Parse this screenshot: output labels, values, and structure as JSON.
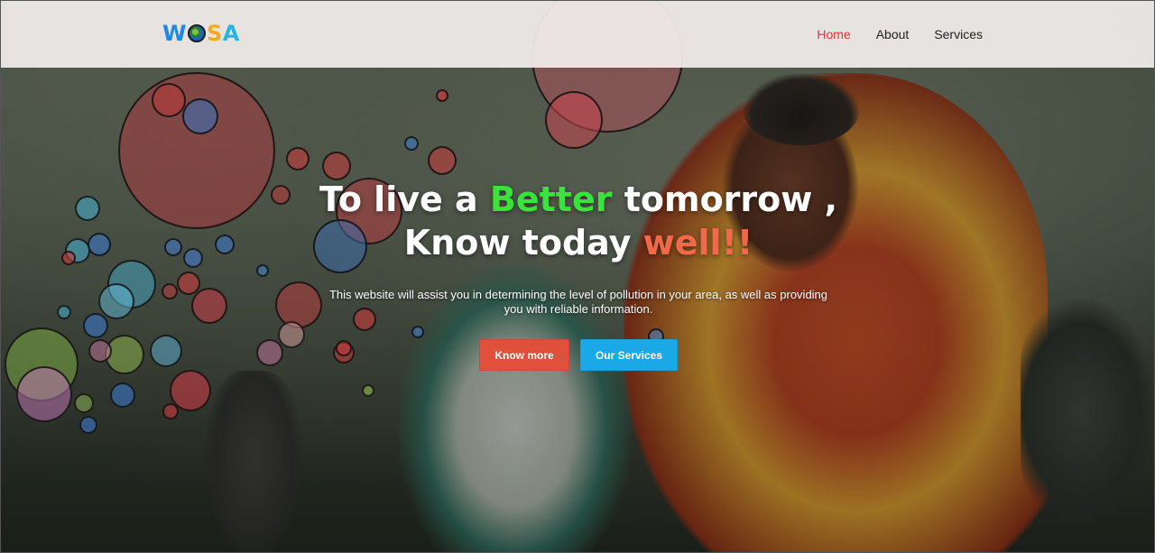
{
  "nav": {
    "logo": {
      "w": "W",
      "s": "S",
      "a": "A",
      "globe": "globe-icon"
    },
    "links": [
      {
        "label": "Home",
        "active": true
      },
      {
        "label": "About",
        "active": false
      },
      {
        "label": "Services",
        "active": false
      }
    ]
  },
  "hero": {
    "line1_pre": "To live a ",
    "line1_highlight": "Better",
    "line1_post": " tomorrow ,",
    "line2_pre": "Know today ",
    "line2_highlight": "well!!",
    "subtext": "This website will assist you in determining the level of pollution in your area, as well as providing you with reliable information."
  },
  "buttons": {
    "know_more": "Know more",
    "our_services": "Our Services"
  },
  "colors": {
    "accent_red": "#e0362c",
    "highlight_green": "#39e43a",
    "highlight_red": "#f06a4a",
    "button_red": "#e0503a",
    "button_blue": "#1aa9e6",
    "logo_blue": "#1e88e5",
    "logo_orange": "#f7a823"
  }
}
